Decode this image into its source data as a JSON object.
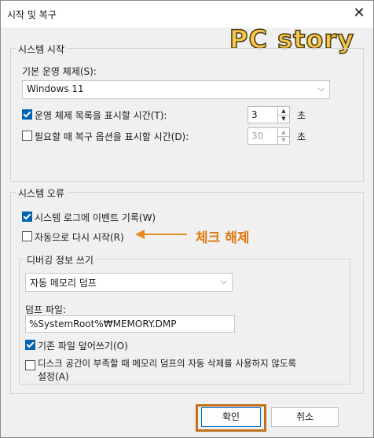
{
  "window": {
    "title": "시작 및 복구",
    "close_glyph": "✕"
  },
  "watermark": "PC story",
  "startup": {
    "legend": "시스템 시작",
    "os_label": "기본 운영 체제(S):",
    "os_value": "Windows 11",
    "show_os_list_label": "운영 체제 목록을 표시할 시간(T):",
    "show_os_list_checked": true,
    "show_os_list_value": "3",
    "seconds_unit": "초",
    "show_recovery_label": "필요할 때 복구 옵션을 표시할 시간(D):",
    "show_recovery_checked": false,
    "show_recovery_value": "30"
  },
  "failure": {
    "legend": "시스템 오류",
    "write_event_label": "시스템 로그에 이벤트 기록(W)",
    "write_event_checked": true,
    "auto_restart_label": "자동으로 다시 시작(R)",
    "auto_restart_checked": false,
    "annotation": "체크 해제",
    "debug": {
      "legend": "디버깅 정보 쓰기",
      "dump_type": "자동 메모리 덤프",
      "dump_file_label": "덤프 파일:",
      "dump_file_value": "%SystemRoot%₩MEMORY.DMP",
      "overwrite_label": "기존 파일 덮어쓰기(O)",
      "overwrite_checked": true,
      "disable_auto_delete_label_line1": "디스크 공간이 부족할 때 메모리 덤프의 자동 삭제를 사용하지 않도록",
      "disable_auto_delete_label_line2": "설정(A)",
      "disable_auto_delete_checked": false
    }
  },
  "buttons": {
    "ok": "확인",
    "cancel": "취소"
  },
  "colors": {
    "accent": "#0063b1",
    "annotation": "#e07a12",
    "focus_ring": "#c0701f"
  }
}
